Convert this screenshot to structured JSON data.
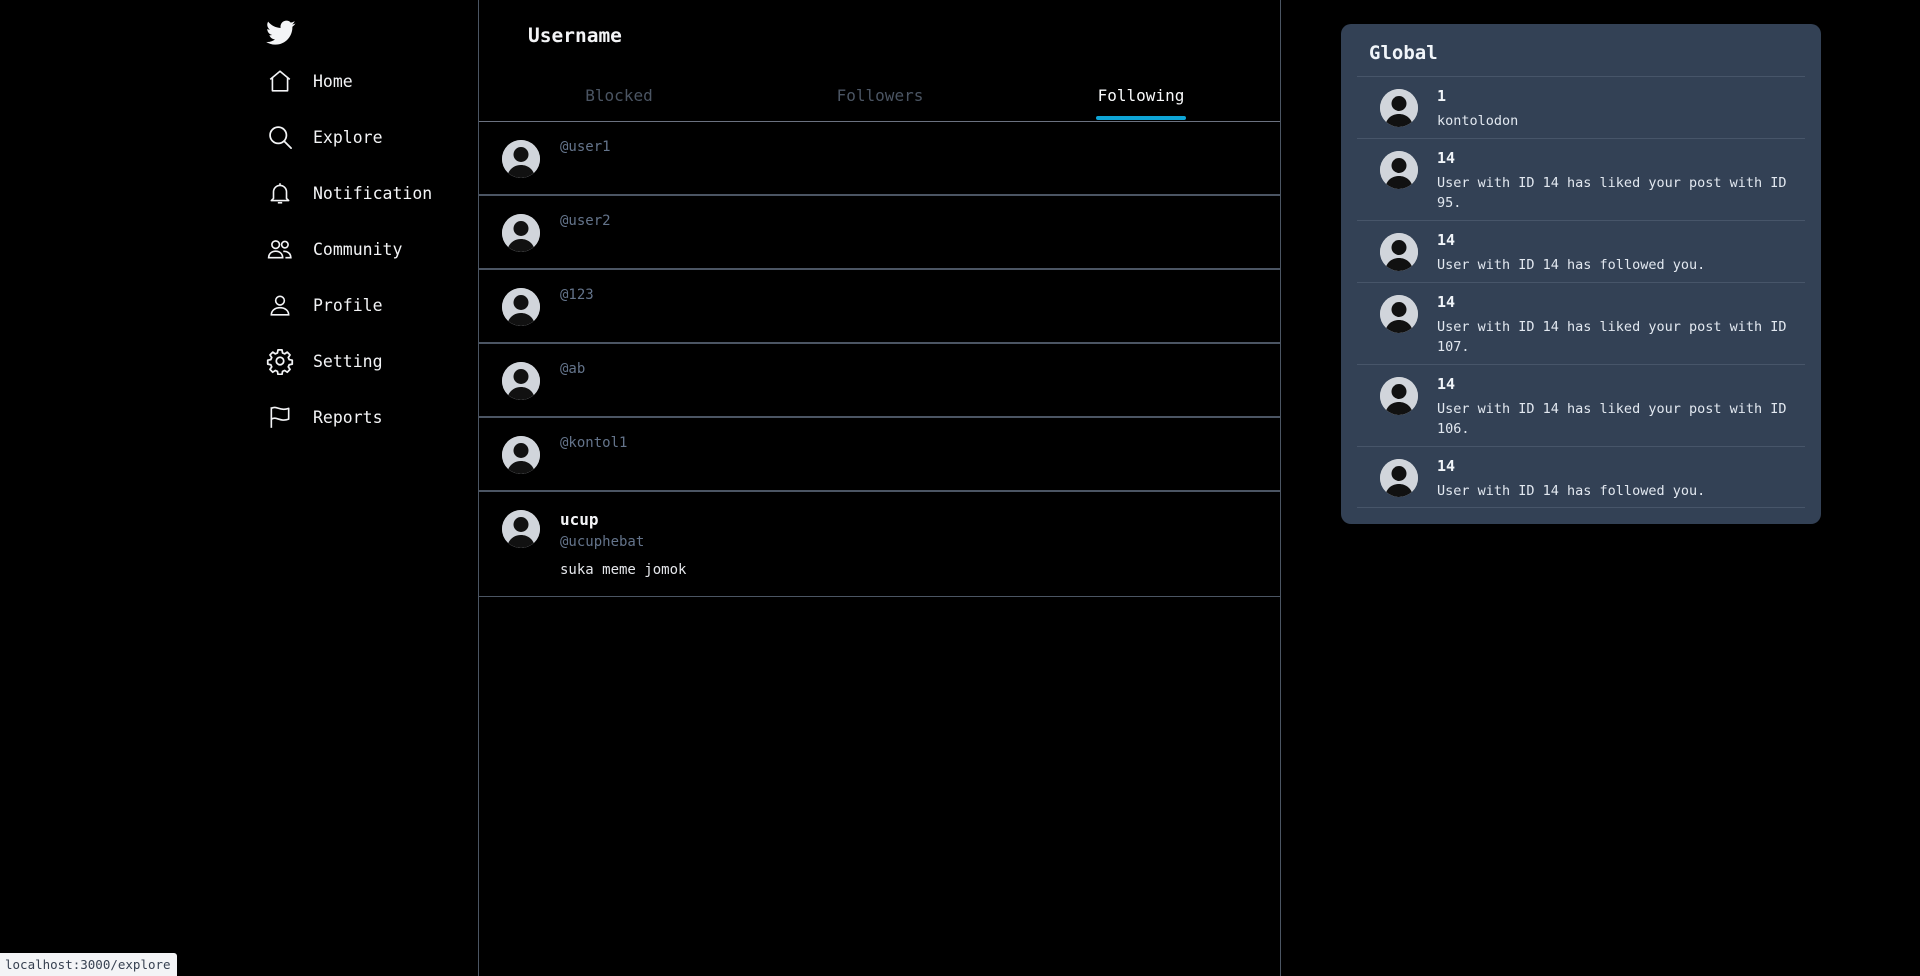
{
  "sidebar": {
    "logo_icon": "twitter-bird-icon",
    "items": [
      {
        "label": "Home",
        "icon": "home-icon"
      },
      {
        "label": "Explore",
        "icon": "search-icon"
      },
      {
        "label": "Notification",
        "icon": "bell-icon"
      },
      {
        "label": "Community",
        "icon": "users-icon"
      },
      {
        "label": "Profile",
        "icon": "user-icon"
      },
      {
        "label": "Setting",
        "icon": "gear-icon"
      },
      {
        "label": "Reports",
        "icon": "flag-icon"
      }
    ]
  },
  "main": {
    "title": "Username",
    "tabs": [
      {
        "label": "Blocked",
        "active": false
      },
      {
        "label": "Followers",
        "active": false
      },
      {
        "label": "Following",
        "active": true
      }
    ],
    "rows": [
      {
        "handle": "@user1"
      },
      {
        "handle": "@user2"
      },
      {
        "handle": "@123"
      },
      {
        "handle": "@ab"
      },
      {
        "handle": "@kontol1"
      },
      {
        "name": "ucup",
        "handle": "@ucuphebat",
        "text": "suka meme jomok"
      }
    ]
  },
  "panel": {
    "title": "Global",
    "items": [
      {
        "title": "1",
        "text": "kontolodon"
      },
      {
        "title": "14",
        "text": "User with ID 14 has liked your post with ID 95."
      },
      {
        "title": "14",
        "text": "User with ID 14 has followed you."
      },
      {
        "title": "14",
        "text": "User with ID 14 has liked your post with ID 107."
      },
      {
        "title": "14",
        "text": "User with ID 14 has liked your post with ID 106."
      },
      {
        "title": "14",
        "text": "User with ID 14 has followed you."
      }
    ]
  },
  "status_url": "localhost:3000/explore",
  "colors": {
    "accent": "#0ea5d6",
    "panel_bg": "#334155",
    "border": "#4b5563"
  }
}
